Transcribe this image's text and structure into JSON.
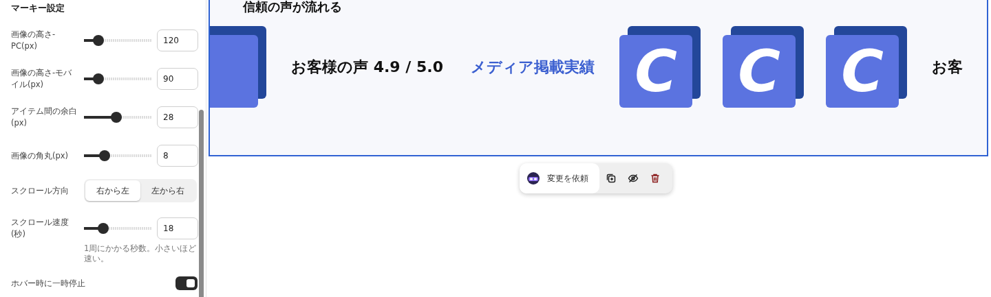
{
  "panel": {
    "title": "マーキー設定",
    "settings": [
      {
        "kind": "slider",
        "label": "画像の高さ-PC(px)",
        "level": 0.21,
        "value": "120"
      },
      {
        "kind": "slider",
        "label": "画像の高さ-モバイル(px)",
        "level": 0.21,
        "value": "90"
      },
      {
        "kind": "slider",
        "label": "アイテム間の余白(px)",
        "level": 0.48,
        "value": "28"
      },
      {
        "kind": "slider",
        "label": "画像の角丸(px)",
        "level": 0.31,
        "value": "8"
      },
      {
        "kind": "segmented",
        "label": "スクロール方向",
        "options": [
          {
            "label": "右から左",
            "selected": true
          },
          {
            "label": "左から右",
            "selected": false
          }
        ]
      },
      {
        "kind": "slider",
        "label": "スクロール速度(秒)",
        "level": 0.29,
        "value": "18",
        "hint": "1周にかかる秒数。小さいほど速い。"
      },
      {
        "kind": "toggle",
        "label": "ホバー時に一時停止",
        "on": true
      }
    ]
  },
  "preview": {
    "title": "信頼の声が流れる",
    "items": [
      {
        "kind": "logo"
      },
      {
        "kind": "text",
        "text": "お客様の声 4.9 / 5.0",
        "color": "#111111"
      },
      {
        "kind": "text",
        "text": "メディア掲載実績",
        "color": "#3b5fd0"
      },
      {
        "kind": "logo",
        "letter": "C"
      },
      {
        "kind": "logo",
        "letter": "C"
      },
      {
        "kind": "logo",
        "letter": "C"
      },
      {
        "kind": "text",
        "text": "お客",
        "color": "#111111"
      }
    ]
  },
  "toolbar": {
    "request_label": "変更を依頼"
  }
}
